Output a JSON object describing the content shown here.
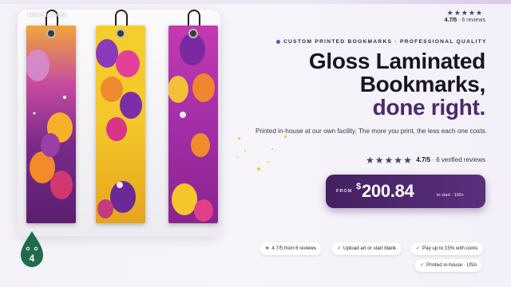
{
  "brand": "4OVER4.COM",
  "mascot": {
    "label": "4"
  },
  "top_rating": {
    "stars": "★★★★★",
    "score": "4.7/5",
    "text": "· 6 reviews"
  },
  "eyebrow": "CUSTOM PRINTED BOOKMARKS · PROFESSIONAL QUALITY",
  "headline": {
    "line1": "Gloss Laminated",
    "line2": "Bookmarks,",
    "line3": "done right."
  },
  "subtitle": "Printed in-house at our own facility. The more you print, the less each one costs.",
  "reviews": {
    "stars": "★★★★★",
    "score": "4.7/5",
    "text": "· 6 verified reviews"
  },
  "price": {
    "from": "FROM",
    "currency": "$",
    "amount": "200.84",
    "tail": "to start · 100+"
  },
  "chips": [
    {
      "icon": "★",
      "label": "4.7/5 from 6 reviews"
    },
    {
      "icon": "✓",
      "label": "Upload art or start blank"
    },
    {
      "icon": "✓",
      "label": "Pay up to 15% with coins"
    },
    {
      "icon": "✓",
      "label": "Printed in-house · USA"
    }
  ],
  "colors": {
    "accent": "#4a2a6c",
    "price_bg": "#4b2668",
    "star": "#4b3f6b"
  }
}
